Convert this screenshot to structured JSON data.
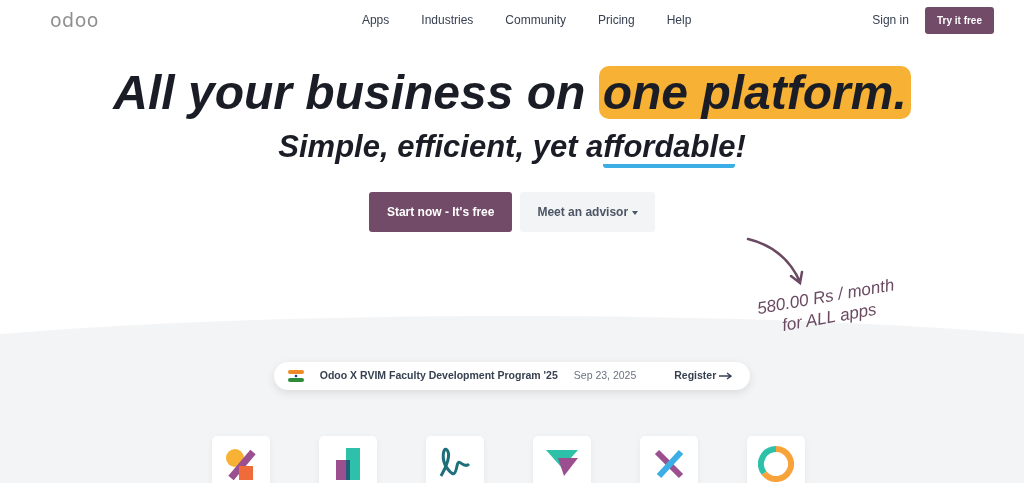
{
  "nav": {
    "logo": "odoo",
    "links": [
      "Apps",
      "Industries",
      "Community",
      "Pricing",
      "Help"
    ],
    "sign_in": "Sign in",
    "cta": "Try it free"
  },
  "hero": {
    "headline": "All your business on ",
    "headline_highlight": "one platform.",
    "subtitle_before": "Simple, efficient, yet a",
    "subtitle_underlined": "ffordable",
    "subtitle_after": "!",
    "primary_button": "Start now - It's free",
    "secondary_button": "Meet an advisor",
    "price_note": [
      "580.00 Rs / month",
      "for ALL apps"
    ]
  },
  "event": {
    "title": "Odoo X RVIM Faculty Development Program '25",
    "date": "Sep 23, 2025",
    "link": "Register"
  },
  "apps": [
    {
      "kind": "sales"
    },
    {
      "kind": "accounting"
    },
    {
      "kind": "sign"
    },
    {
      "kind": "timesheets"
    },
    {
      "kind": "services"
    },
    {
      "kind": "project"
    }
  ]
}
